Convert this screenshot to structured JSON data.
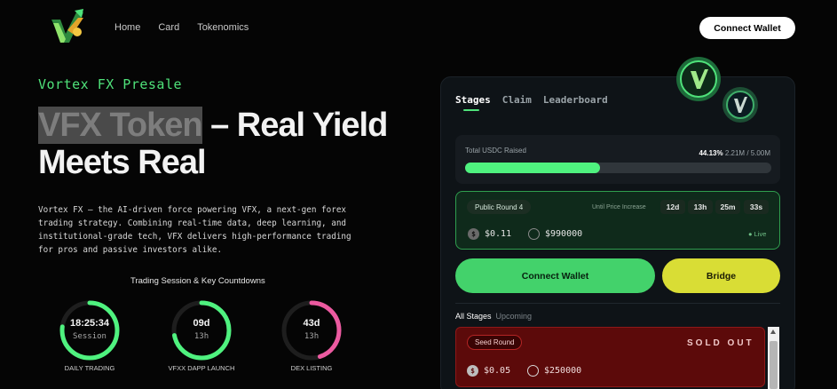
{
  "nav": {
    "items": [
      "Home",
      "Card",
      "Tokenomics"
    ],
    "connect_label": "Connect Wallet"
  },
  "hero": {
    "presale_label": "Vortex FX Presale",
    "title_highlight": "VFX Token",
    "title_rest": " – Real Yield Meets Real",
    "description": "Vortex FX — the AI-driven force powering VFX, a next-gen forex trading strategy. Combining real-time data, deep learning, and institutional-grade tech, VFX delivers high-performance trading for pros and passive investors alike."
  },
  "session": {
    "title": "Trading Session & Key Countdowns",
    "rings": [
      {
        "value": "18:25:34",
        "sub": "Session",
        "label": "DAILY TRADING",
        "progress": 0.77,
        "color": "#4ff27f"
      },
      {
        "value": "09d",
        "sub": "13h",
        "label": "VFXX DAPP LAUNCH",
        "progress": 0.72,
        "color": "#4ff27f"
      },
      {
        "value": "43d",
        "sub": "13h",
        "label": "DEX LISTING",
        "progress": 0.45,
        "color": "#ec5aa0"
      }
    ]
  },
  "panel": {
    "tabs": [
      "Stages",
      "Claim",
      "Leaderboard"
    ],
    "active_tab": "Stages",
    "raised_label": "Total USDC Raised",
    "raised_percent": "44.13%",
    "raised_amount": "2.21M / 5.00M",
    "raised_progress": 0.4413,
    "round_label": "Public Round 4",
    "until_label": "Until Price Increase",
    "countdown": [
      "12d",
      "13h",
      "25m",
      "33s"
    ],
    "round_price": "$0.11",
    "round_cap": "$990000",
    "live_label": "● Live",
    "connect_label": "Connect Wallet",
    "bridge_label": "Bridge",
    "stage_tabs": [
      "All Stages",
      "Upcoming"
    ],
    "seed_label": "Seed Round",
    "sold_out": "SOLD OUT",
    "seed_price": "$0.05",
    "seed_cap": "$250000"
  },
  "icons": [
    "logo-icon",
    "coin-icon",
    "dollar-icon",
    "circle-target-icon",
    "scroll-up-icon"
  ]
}
